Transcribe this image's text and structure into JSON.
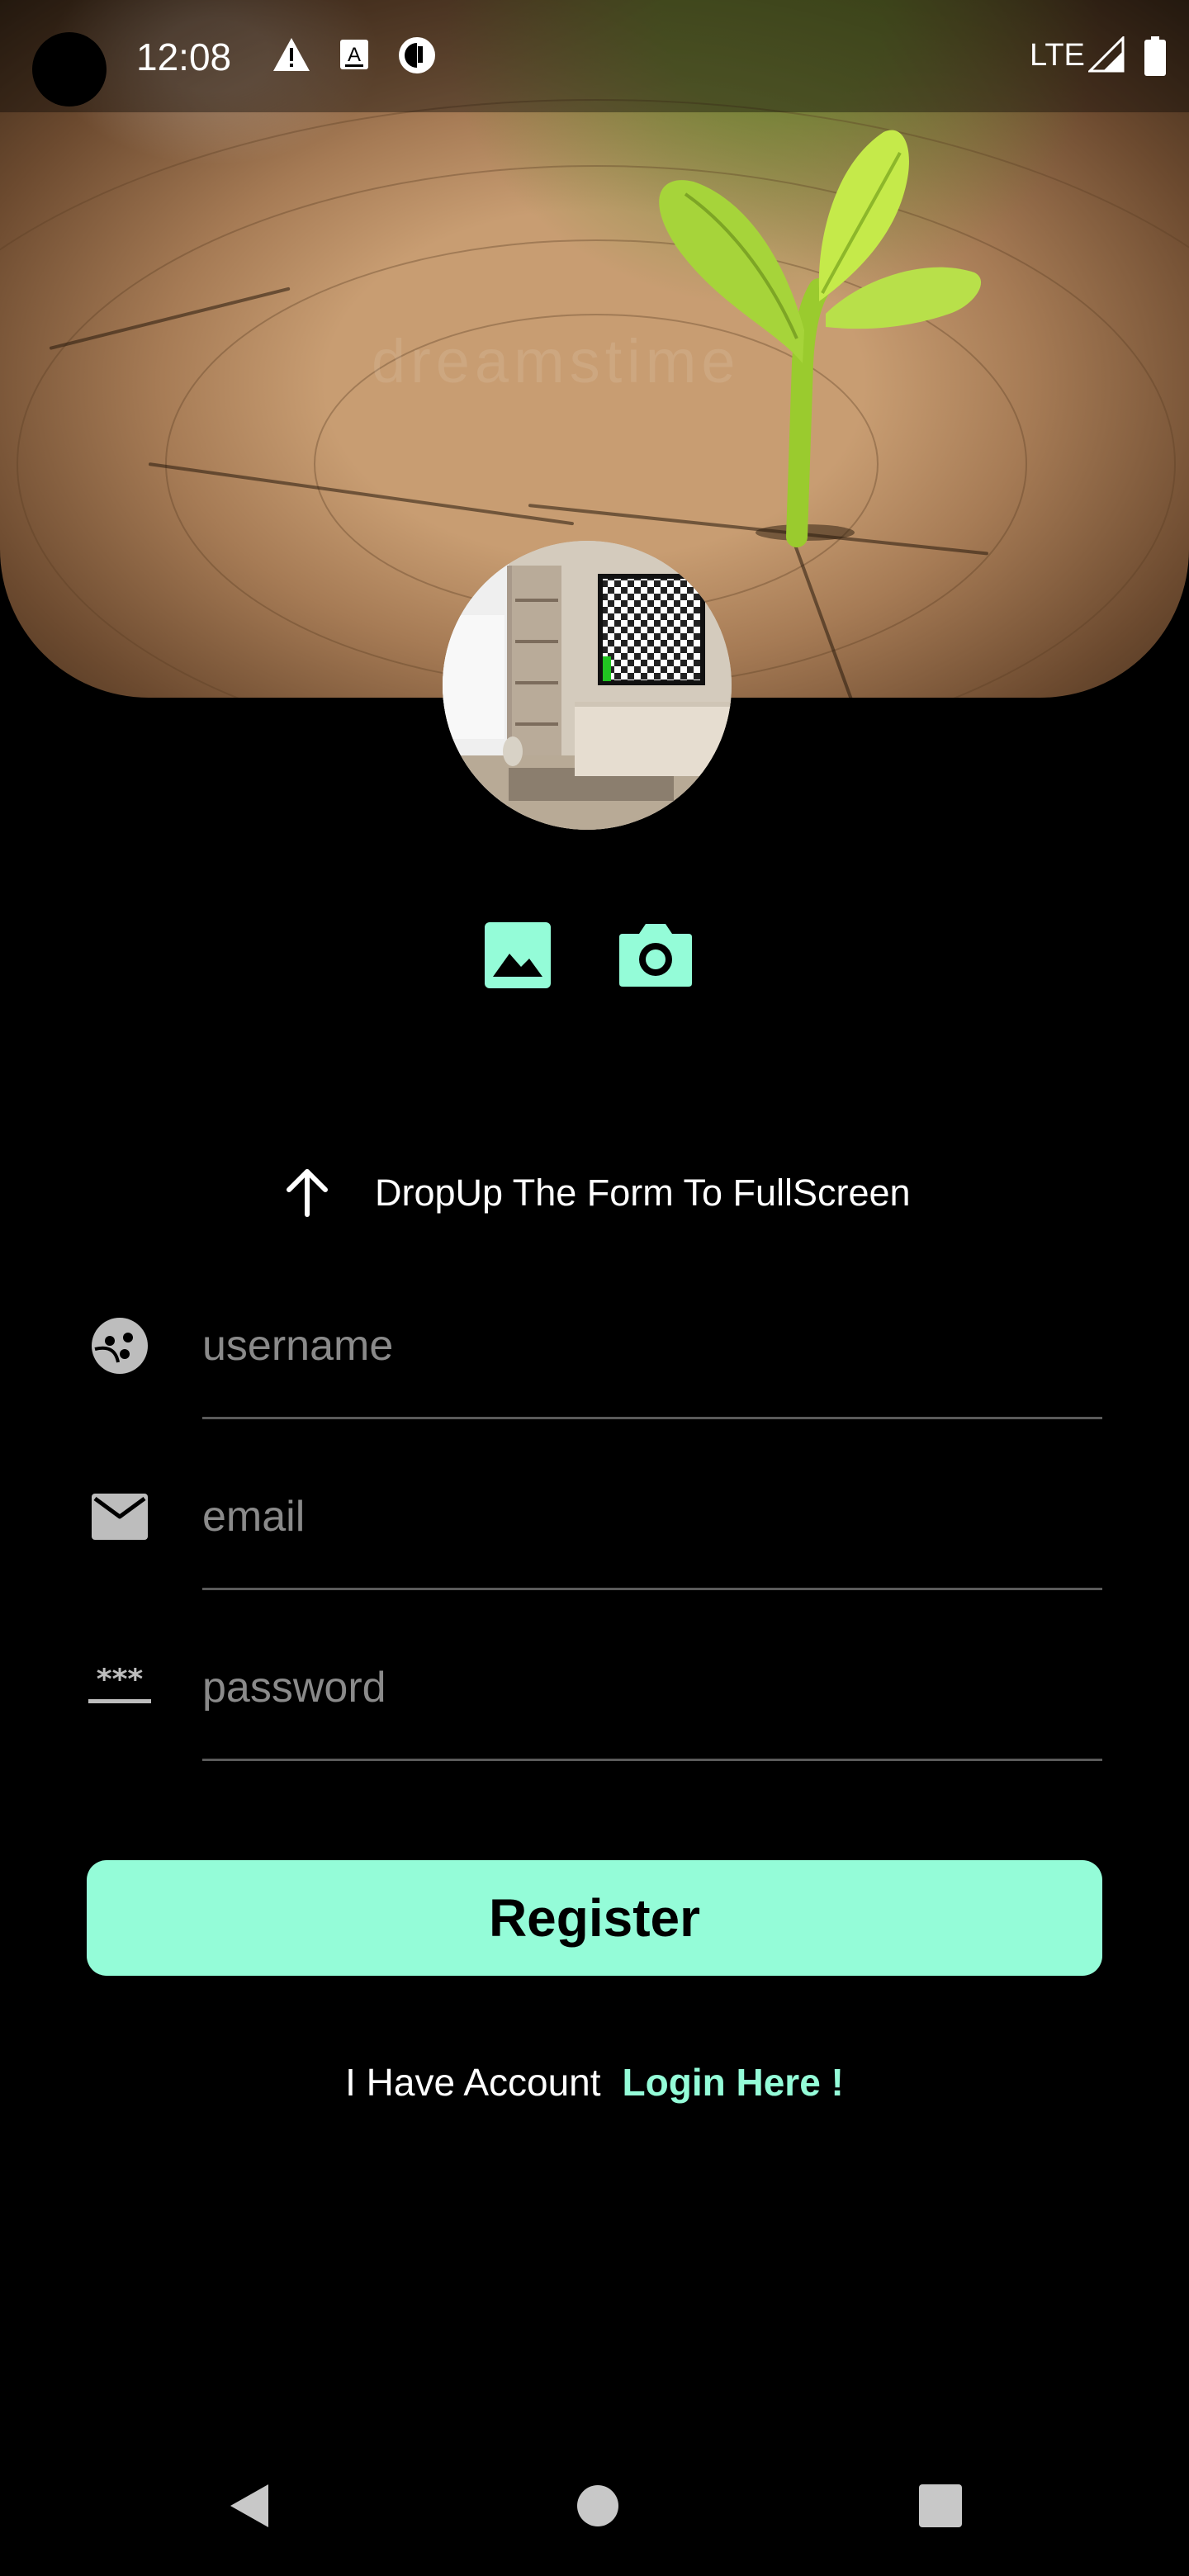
{
  "status_bar": {
    "time": "12:08",
    "network": "LTE",
    "icons": [
      "warning-icon",
      "a-box-icon",
      "circle-app-icon",
      "signal-icon",
      "battery-icon"
    ]
  },
  "header": {
    "image": "tree-stump-sprout-photo",
    "watermark": "dreamstime"
  },
  "avatar": {
    "image": "living-room-photo"
  },
  "picker": {
    "gallery_icon": "image-icon",
    "camera_icon": "camera-icon"
  },
  "dropup": {
    "icon": "arrow-up-icon",
    "text": "DropUp The Form To FullScreen"
  },
  "form": {
    "username": {
      "placeholder": "username",
      "value": "",
      "icon": "face-icon"
    },
    "email": {
      "placeholder": "email",
      "value": "",
      "icon": "mail-icon"
    },
    "password": {
      "placeholder": "password",
      "value": "",
      "icon": "password-icon"
    },
    "register_label": "Register"
  },
  "login": {
    "text": "I Have Account",
    "link": "Login Here !"
  },
  "nav": {
    "back": "back-icon",
    "home": "home-icon",
    "recents": "recents-icon"
  },
  "colors": {
    "accent": "#94fcd8",
    "background": "#000000",
    "placeholder": "#8a8a8a",
    "underline": "#5a5a5a"
  }
}
